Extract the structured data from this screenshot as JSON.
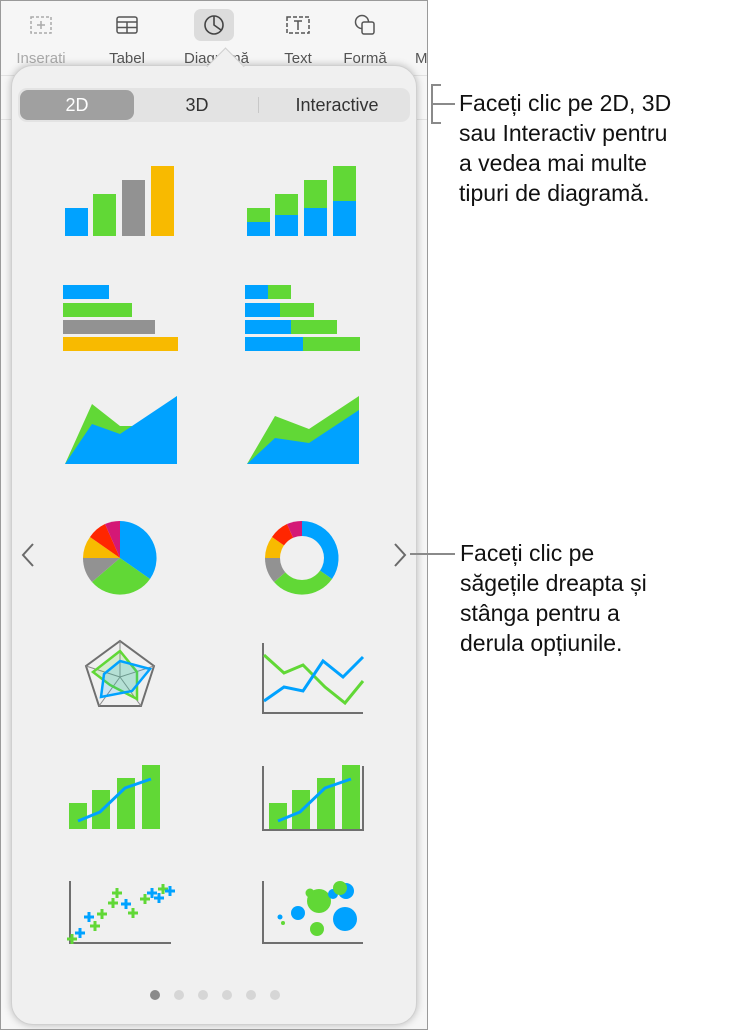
{
  "toolbar": {
    "items": [
      {
        "label": "Inserati",
        "icon": "insert-icon",
        "dimmed": true
      },
      {
        "label": "Tabel",
        "icon": "table-icon"
      },
      {
        "label": "Diagramă",
        "icon": "chart-icon",
        "active": true
      },
      {
        "label": "Text",
        "icon": "text-box-icon"
      },
      {
        "label": "Formă",
        "icon": "shape-icon"
      },
      {
        "label": "M"
      }
    ]
  },
  "popover": {
    "segments": [
      {
        "label": "2D",
        "selected": true
      },
      {
        "label": "3D",
        "selected": false
      },
      {
        "label": "Interactive",
        "selected": false
      }
    ],
    "chart_types": [
      {
        "name": "column"
      },
      {
        "name": "stacked-column"
      },
      {
        "name": "bar"
      },
      {
        "name": "stacked-bar"
      },
      {
        "name": "area"
      },
      {
        "name": "stacked-area"
      },
      {
        "name": "pie"
      },
      {
        "name": "donut"
      },
      {
        "name": "radar"
      },
      {
        "name": "line"
      },
      {
        "name": "mixed"
      },
      {
        "name": "two-axis"
      },
      {
        "name": "scatter"
      },
      {
        "name": "bubble"
      }
    ],
    "page_indicator": {
      "current": 1,
      "total": 6
    },
    "colors": {
      "blue": "#00a2ff",
      "green": "#61d836",
      "gray": "#929292",
      "yellow": "#f8ba00",
      "red": "#ff2600",
      "magenta": "#d41876"
    }
  },
  "callouts": {
    "top": "Faceți clic pe 2D, 3D sau Interactiv pentru a vedea mai multe tipuri de diagramă.",
    "top_lines": [
      "Faceți clic pe 2D, 3D",
      "sau Interactiv pentru",
      "a vedea mai multe",
      "tipuri de diagramă."
    ],
    "middle_lines": [
      "Faceți clic pe",
      "săgețile dreapta și",
      "stânga pentru a",
      "derula opțiunile."
    ]
  }
}
